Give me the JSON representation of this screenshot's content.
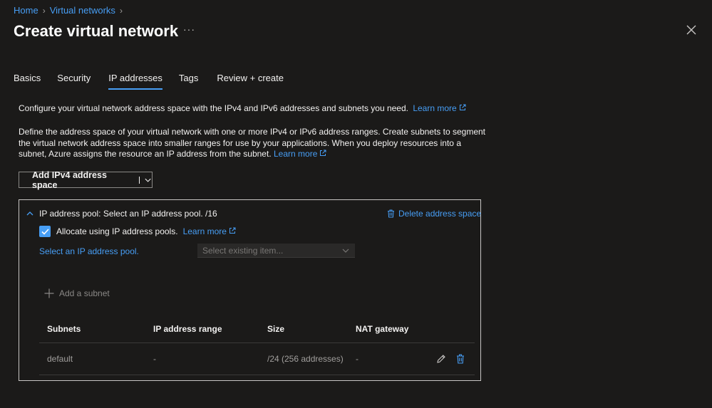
{
  "breadcrumb": {
    "home": "Home",
    "virtual_networks": "Virtual networks"
  },
  "header": {
    "title": "Create virtual network",
    "more": "···"
  },
  "tabs": [
    {
      "label": "Basics"
    },
    {
      "label": "Security"
    },
    {
      "label": "IP addresses",
      "active": true
    },
    {
      "label": "Tags"
    },
    {
      "label": "Review + create"
    }
  ],
  "intro": {
    "text": "Configure your virtual network address space with the IPv4 and IPv6 addresses and subnets you need.",
    "learn_more": "Learn more"
  },
  "description": {
    "text": "Define the address space of your virtual network with one or more IPv4 or IPv6 address ranges. Create subnets to segment the virtual network address space into smaller ranges for use by your applications. When you deploy resources into a subnet, Azure assigns the resource an IP address from the subnet.",
    "learn_more": "Learn more"
  },
  "add_space_button": {
    "label": "Add IPv4 address space"
  },
  "pool": {
    "header": "IP address pool: Select an IP address pool. /16",
    "delete_label": "Delete address space",
    "allocate_label": "Allocate using IP address pools.",
    "allocate_checked": true,
    "learn_more": "Learn more",
    "select_pool_link": "Select an IP address pool.",
    "select_placeholder": "Select existing item...",
    "add_subnet": "Add a subnet"
  },
  "subnets_table": {
    "columns": [
      "Subnets",
      "IP address range",
      "Size",
      "NAT gateway"
    ],
    "rows": [
      {
        "name": "default",
        "range": "-",
        "size": "/24 (256 addresses)",
        "nat": "-"
      }
    ]
  },
  "colors": {
    "accent": "#479ef5",
    "background": "#1b1a19",
    "text": "#f3f2f1",
    "muted": "#a19f9d"
  }
}
